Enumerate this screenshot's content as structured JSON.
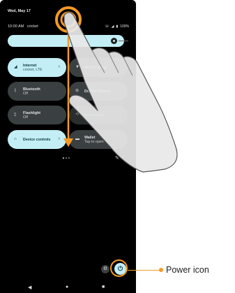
{
  "status": {
    "date": "Wed, May 17",
    "time": "10:00 AM",
    "carrier": "cricket",
    "battery": "100%"
  },
  "tiles": [
    {
      "title": "Internet",
      "subtitle": "cricket, LTE",
      "icon": "signal-icon",
      "state": "on"
    },
    {
      "title": "Wi-Fi Calling",
      "subtitle": "",
      "icon": "wifi-calling-icon",
      "state": "off"
    },
    {
      "title": "Bluetooth",
      "subtitle": "Off",
      "icon": "bluetooth-icon",
      "state": "off"
    },
    {
      "title": "Do Not Disturb",
      "subtitle": "",
      "icon": "do-not-disturb-icon",
      "state": "off"
    },
    {
      "title": "Flashlight",
      "subtitle": "Off",
      "icon": "flashlight-icon",
      "state": "off"
    },
    {
      "title": "Auto-rotate",
      "subtitle": "",
      "icon": "rotate-icon",
      "state": "off"
    },
    {
      "title": "Device controls",
      "subtitle": "",
      "icon": "home-icon",
      "state": "on"
    },
    {
      "title": "Wallet",
      "subtitle": "Tap to open",
      "icon": "wallet-icon",
      "state": "off"
    }
  ],
  "callout": {
    "label": "Power icon"
  }
}
